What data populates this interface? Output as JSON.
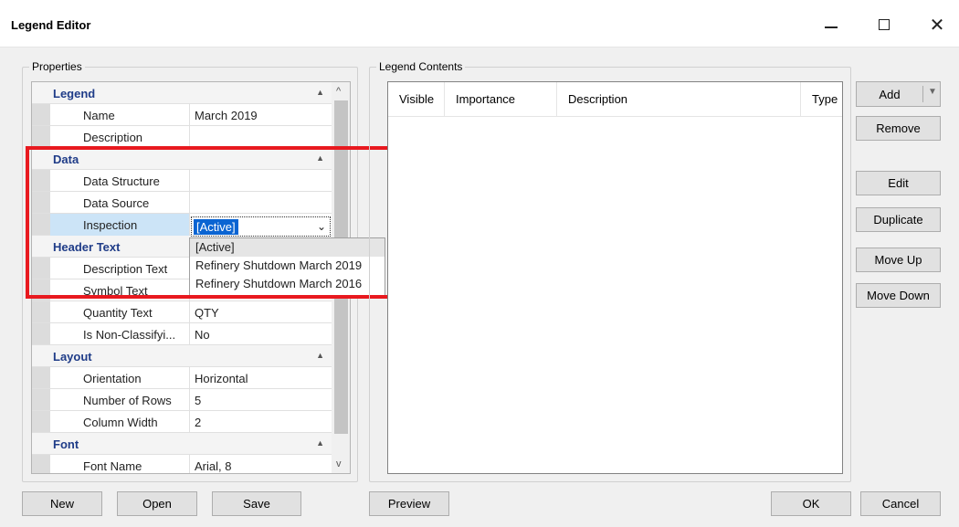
{
  "window": {
    "title": "Legend Editor",
    "min_icon": "minimize-icon",
    "max_icon": "maximize-icon",
    "close_icon": "close-icon",
    "close_glyph": "✕"
  },
  "properties_group": {
    "label": "Properties",
    "categories": [
      {
        "label": "Legend",
        "rows": [
          {
            "name": "Name",
            "value": "March 2019"
          },
          {
            "name": "Description",
            "value": ""
          }
        ]
      },
      {
        "label": "Data",
        "rows": [
          {
            "name": "Data Structure",
            "value": ""
          },
          {
            "name": "Data Source",
            "value": ""
          },
          {
            "name": "Inspection",
            "value": "[Active]"
          }
        ]
      },
      {
        "label": "Header Text",
        "rows": [
          {
            "name": "Description Text",
            "value": ""
          },
          {
            "name": "Symbol Text",
            "value": ""
          },
          {
            "name": "Quantity Text",
            "value": "QTY"
          },
          {
            "name": "Is Non-Classifyi...",
            "value": "No"
          }
        ]
      },
      {
        "label": "Layout",
        "rows": [
          {
            "name": "Orientation",
            "value": "Horizontal"
          },
          {
            "name": "Number of Rows",
            "value": "5"
          },
          {
            "name": "Column Width",
            "value": "2"
          }
        ]
      },
      {
        "label": "Font",
        "rows": [
          {
            "name": "Font Name",
            "value": "Arial, 8"
          }
        ]
      }
    ],
    "inspection_dropdown": {
      "selected": "[Active]",
      "options": [
        "[Active]",
        "Refinery Shutdown March 2019",
        "Refinery Shutdown March 2016"
      ]
    }
  },
  "legend_contents_group": {
    "label": "Legend Contents",
    "columns": [
      "Visible",
      "Importance",
      "Description",
      "Type"
    ],
    "rows": []
  },
  "side_buttons": {
    "add": "Add",
    "remove": "Remove",
    "edit": "Edit",
    "duplicate": "Duplicate",
    "move_up": "Move Up",
    "move_down": "Move Down"
  },
  "bottom_buttons": {
    "new": "New",
    "open": "Open",
    "save": "Save",
    "preview": "Preview",
    "ok": "OK",
    "cancel": "Cancel"
  },
  "highlight_color": "#e8191f"
}
